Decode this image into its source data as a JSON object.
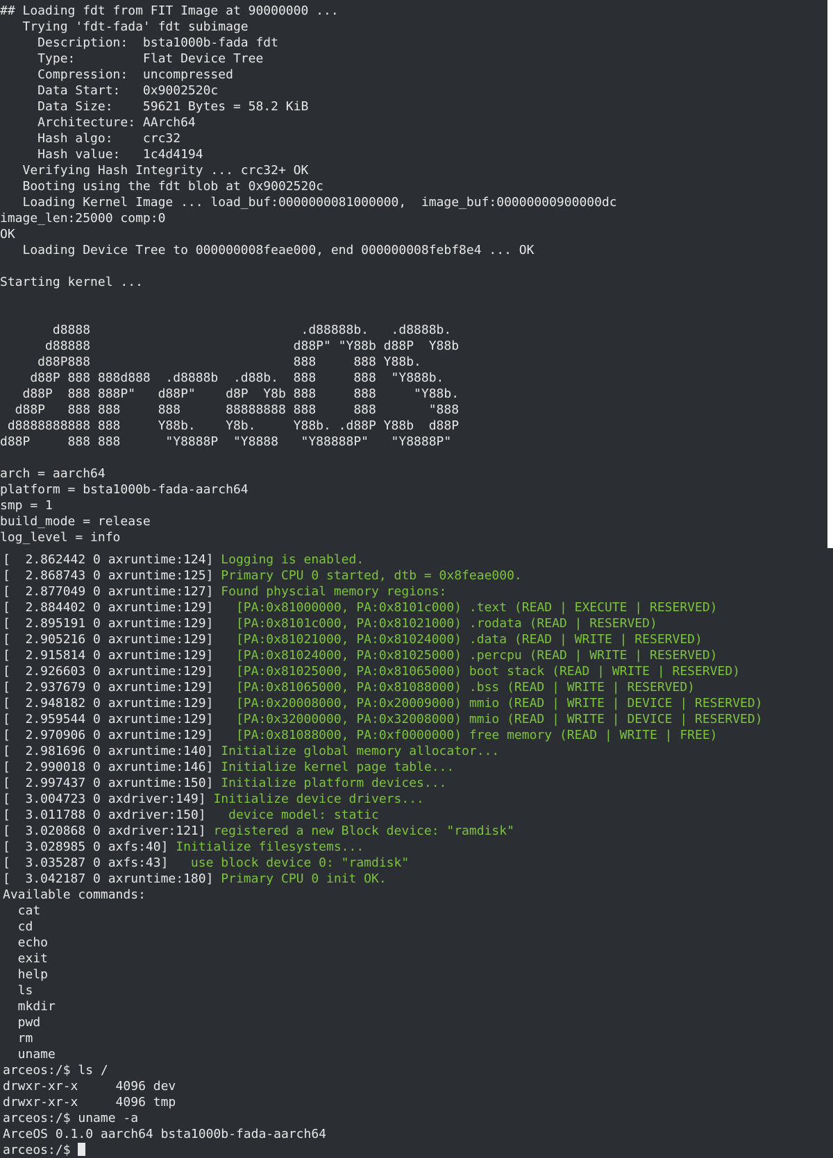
{
  "boot_output": [
    "## Loading fdt from FIT Image at 90000000 ...",
    "   Trying 'fdt-fada' fdt subimage",
    "     Description:  bsta1000b-fada fdt",
    "     Type:         Flat Device Tree",
    "     Compression:  uncompressed",
    "     Data Start:   0x9002520c",
    "     Data Size:    59621 Bytes = 58.2 KiB",
    "     Architecture: AArch64",
    "     Hash algo:    crc32",
    "     Hash value:   1c4d4194",
    "   Verifying Hash Integrity ... crc32+ OK",
    "   Booting using the fdt blob at 0x9002520c",
    "   Loading Kernel Image ... load_buf:0000000081000000,  image_buf:00000000900000dc",
    "image_len:25000 comp:0",
    "OK",
    "   Loading Device Tree to 000000008feae000, end 000000008febf8e4 ... OK",
    "",
    "Starting kernel ...",
    "",
    "",
    "       d8888                            .d88888b.   .d8888b.",
    "      d88888                           d88P\" \"Y88b d88P  Y88b",
    "     d88P888                           888     888 Y88b.",
    "    d88P 888 888d888  .d8888b  .d88b.  888     888  \"Y888b.",
    "   d88P  888 888P\"   d88P\"    d8P  Y8b 888     888     \"Y88b.",
    "  d88P   888 888     888      88888888 888     888       \"888",
    " d8888888888 888     Y88b.    Y8b.     Y88b. .d88P Y88b  d88P",
    "d88P     888 888      \"Y8888P  \"Y8888   \"Y88888P\"   \"Y8888P\"",
    "",
    "arch = aarch64",
    "platform = bsta1000b-fada-aarch64",
    "smp = 1",
    "build_mode = release",
    "log_level = info"
  ],
  "log_lines": [
    {
      "prefix": "[  2.862442 0 axruntime:124] ",
      "message": "Logging is enabled."
    },
    {
      "prefix": "[  2.868743 0 axruntime:125] ",
      "message": "Primary CPU 0 started, dtb = 0x8feae000."
    },
    {
      "prefix": "[  2.877049 0 axruntime:127] ",
      "message": "Found physcial memory regions:"
    },
    {
      "prefix": "[  2.884402 0 axruntime:129] ",
      "message": "  [PA:0x81000000, PA:0x8101c000) .text (READ | EXECUTE | RESERVED)"
    },
    {
      "prefix": "[  2.895191 0 axruntime:129] ",
      "message": "  [PA:0x8101c000, PA:0x81021000) .rodata (READ | RESERVED)"
    },
    {
      "prefix": "[  2.905216 0 axruntime:129] ",
      "message": "  [PA:0x81021000, PA:0x81024000) .data (READ | WRITE | RESERVED)"
    },
    {
      "prefix": "[  2.915814 0 axruntime:129] ",
      "message": "  [PA:0x81024000, PA:0x81025000) .percpu (READ | WRITE | RESERVED)"
    },
    {
      "prefix": "[  2.926603 0 axruntime:129] ",
      "message": "  [PA:0x81025000, PA:0x81065000) boot stack (READ | WRITE | RESERVED)"
    },
    {
      "prefix": "[  2.937679 0 axruntime:129] ",
      "message": "  [PA:0x81065000, PA:0x81088000) .bss (READ | WRITE | RESERVED)"
    },
    {
      "prefix": "[  2.948182 0 axruntime:129] ",
      "message": "  [PA:0x20008000, PA:0x20009000) mmio (READ | WRITE | DEVICE | RESERVED)"
    },
    {
      "prefix": "[  2.959544 0 axruntime:129] ",
      "message": "  [PA:0x32000000, PA:0x32008000) mmio (READ | WRITE | DEVICE | RESERVED)"
    },
    {
      "prefix": "[  2.970906 0 axruntime:129] ",
      "message": "  [PA:0x81088000, PA:0xf0000000) free memory (READ | WRITE | FREE)"
    },
    {
      "prefix": "[  2.981696 0 axruntime:140] ",
      "message": "Initialize global memory allocator..."
    },
    {
      "prefix": "[  2.990018 0 axruntime:146] ",
      "message": "Initialize kernel page table..."
    },
    {
      "prefix": "[  2.997437 0 axruntime:150] ",
      "message": "Initialize platform devices..."
    },
    {
      "prefix": "[  3.004723 0 axdriver:149] ",
      "message": "Initialize device drivers..."
    },
    {
      "prefix": "[  3.011788 0 axdriver:150] ",
      "message": "  device model: static"
    },
    {
      "prefix": "[  3.020868 0 axdriver:121] ",
      "message": "registered a new Block device: \"ramdisk\""
    },
    {
      "prefix": "[  3.028985 0 axfs:40] ",
      "message": "Initialize filesystems..."
    },
    {
      "prefix": "[  3.035287 0 axfs:43] ",
      "message": "  use block device 0: \"ramdisk\""
    },
    {
      "prefix": "[  3.042187 0 axruntime:180] ",
      "message": "Primary CPU 0 init OK."
    }
  ],
  "shell_output": [
    "Available commands:",
    "  cat",
    "  cd",
    "  echo",
    "  exit",
    "  help",
    "  ls",
    "  mkdir",
    "  pwd",
    "  rm",
    "  uname",
    "arceos:/$ ls /",
    "drwxr-xr-x     4096 dev",
    "drwxr-xr-x     4096 tmp",
    "arceos:/$ uname -a",
    "ArceOS 0.1.0 aarch64 bsta1000b-fada-aarch64"
  ],
  "prompt": {
    "text": "arceos:/$ "
  },
  "colors": {
    "background": "#2b2e33",
    "foreground": "#e8e8e8",
    "log_message": "#7cc43c"
  }
}
